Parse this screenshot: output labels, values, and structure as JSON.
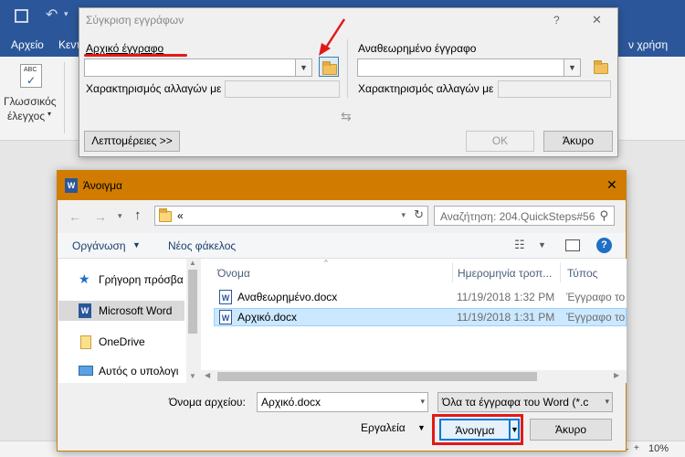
{
  "word": {
    "quick_access": {
      "save_icon": "save-icon",
      "undo_icon": "undo-icon"
    },
    "ribbon_tabs": [
      "Αρχείο",
      "Κεντ"
    ],
    "signin_text": "ν χρήση",
    "ribbon": {
      "proofing_label_line1": "Γλωσσικός",
      "proofing_label_line2": "έλεγχος",
      "abc_label": "ABC"
    },
    "status": {
      "zoom": "10%"
    }
  },
  "compare_dialog": {
    "title": "Σύγκριση εγγράφων",
    "help": "?",
    "close": "✕",
    "original_label": "Αρχικό έγγραφο",
    "original_value": "",
    "revised_label": "Αναθεωρημένο έγγραφο",
    "revised_value": "",
    "label_changes_left": "Χαρακτηρισμός αλλαγών με",
    "label_changes_right": "Χαρακτηρισμός αλλαγών με",
    "swap_icon": "⇆",
    "more_button": "Λεπτομέρειες >>",
    "ok_button": "OK",
    "cancel_button": "Άκυρο"
  },
  "open_dialog": {
    "title": "Άνοιγμα",
    "close": "✕",
    "path": "«",
    "search_placeholder": "Αναζήτηση: 204.QuickSteps#56",
    "organize": "Οργάνωση",
    "new_folder": "Νέος φάκελος",
    "help": "?",
    "nav_items": [
      {
        "label": "Γρήγορη πρόσβα",
        "icon": "star-icon"
      },
      {
        "label": "Microsoft Word",
        "icon": "word-icon"
      },
      {
        "label": "OneDrive",
        "icon": "onedrive-icon"
      },
      {
        "label": "Αυτός ο υπολογι",
        "icon": "computer-icon"
      }
    ],
    "columns": {
      "name": "Όνομα",
      "date": "Ημερομηνία τροπ...",
      "type": "Τύπος"
    },
    "files": [
      {
        "name": "Αναθεωρημένο.docx",
        "date": "11/19/2018 1:32 PM",
        "type": "Έγγραφο το"
      },
      {
        "name": "Αρχικό.docx",
        "date": "11/19/2018 1:31 PM",
        "type": "Έγγραφο το"
      }
    ],
    "filename_label": "Όνομα αρχείου:",
    "filename_value": "Αρχικό.docx",
    "filter_value": "Όλα τα έγγραφα του Word (*.c",
    "tools": "Εργαλεία",
    "open_button": "Άνοιγμα",
    "cancel_button": "Άκυρο"
  },
  "colors": {
    "word_blue": "#2b579a",
    "open_title": "#d17c00",
    "annotation_red": "#e01a1a",
    "selection": "#cce8ff"
  }
}
